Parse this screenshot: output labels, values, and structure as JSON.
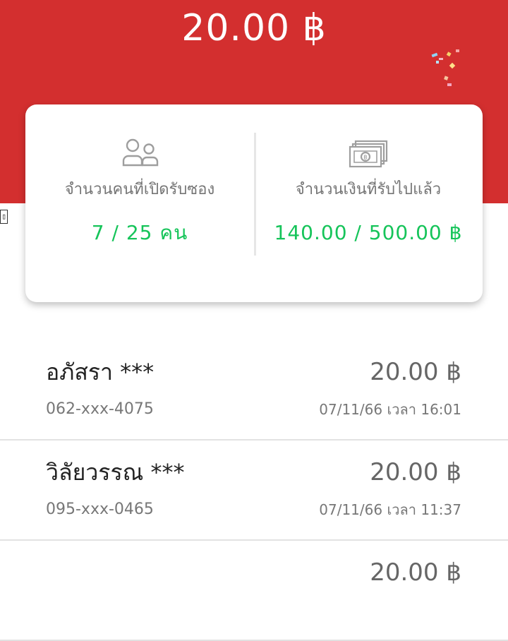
{
  "header": {
    "amount": "20.00 ฿"
  },
  "stats": {
    "people": {
      "icon": "people-icon",
      "label": "จำนวนคนที่เปิดรับซอง",
      "value": "7 / 25 คน"
    },
    "money": {
      "icon": "banknote-icon",
      "label": "จำนวนเงินที่รับไปแล้ว",
      "value": "140.00 / 500.00 ฿"
    }
  },
  "edge_glyph": "▯",
  "colors": {
    "header": "#d32f2f",
    "accent_green": "#16c45a"
  },
  "recipients": [
    {
      "name": "อภัสรา ***",
      "amount": "20.00 ฿",
      "phone": "062-xxx-4075",
      "time": "07/11/66 เวลา 16:01"
    },
    {
      "name": "วิลัยวรรณ ***",
      "amount": "20.00 ฿",
      "phone": "095-xxx-0465",
      "time": "07/11/66 เวลา 11:37"
    },
    {
      "name": "",
      "amount": "20.00 ฿",
      "phone": "",
      "time": ""
    }
  ]
}
